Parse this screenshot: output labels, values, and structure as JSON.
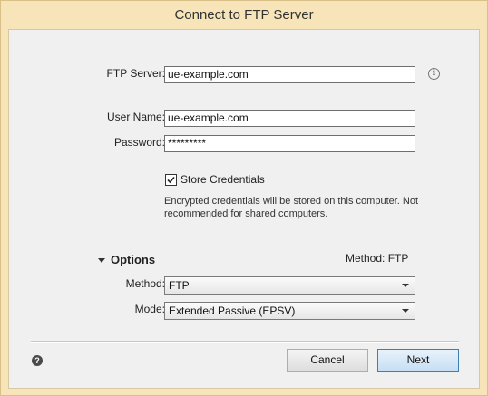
{
  "window": {
    "title": "Connect to FTP Server"
  },
  "form": {
    "server_label": "FTP Server:",
    "server_value": "ue-example.com",
    "info_icon": "info-icon",
    "username_label": "User Name:",
    "username_value": "ue-example.com",
    "password_label": "Password:",
    "password_value": "*********",
    "store_credentials_label": "Store Credentials",
    "store_credentials_checked": true,
    "credentials_note": "Encrypted credentials will be stored on this computer. Not recommended for shared computers."
  },
  "options": {
    "toggle_label": "Options",
    "summary": "Method: FTP",
    "method_label": "Method:",
    "method_value": "FTP",
    "mode_label": "Mode:",
    "mode_value": "Extended Passive (EPSV)"
  },
  "footer": {
    "help_icon": "question-icon",
    "cancel_label": "Cancel",
    "next_label": "Next"
  },
  "colors": {
    "title_bar": "#f7e4b9",
    "client_bg": "#f0f0f0",
    "primary_button_border": "#3c7fb1"
  }
}
